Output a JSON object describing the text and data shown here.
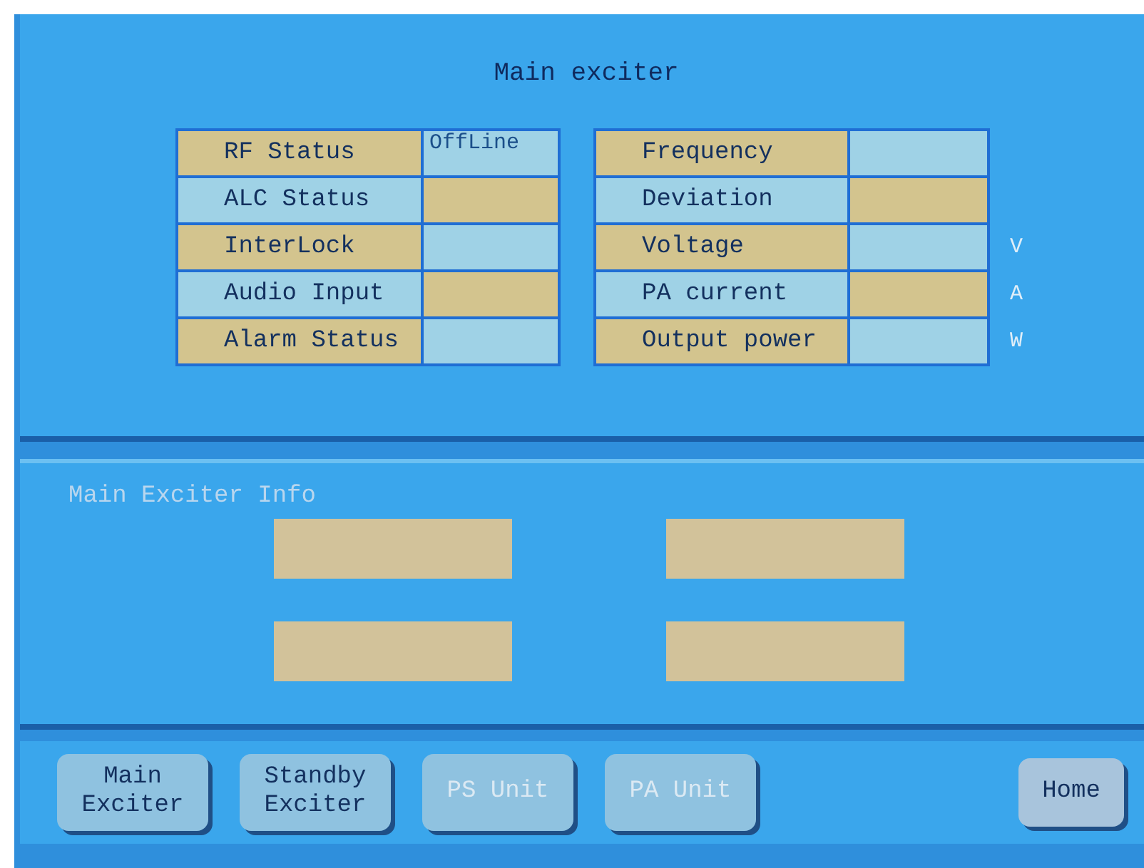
{
  "title": "Main exciter",
  "status_table": [
    {
      "label": "RF Status",
      "value": "OffLine"
    },
    {
      "label": "ALC Status"
    },
    {
      "label": "InterLock"
    },
    {
      "label": "Audio Input"
    },
    {
      "label": "Alarm Status"
    }
  ],
  "measure_table": [
    {
      "label": "Frequency"
    },
    {
      "label": "Deviation"
    },
    {
      "label": "Voltage",
      "unit": "V"
    },
    {
      "label": "PA current",
      "unit": "A"
    },
    {
      "label": "Output power",
      "unit": "W"
    }
  ],
  "info": {
    "title": "Main Exciter Info"
  },
  "nav_buttons": [
    {
      "label": "Main\nExciter",
      "disabled": false
    },
    {
      "label": "Standby\nExciter",
      "disabled": false
    },
    {
      "label": "PS Unit",
      "disabled": true
    },
    {
      "label": "PA Unit",
      "disabled": true
    }
  ],
  "home_button": {
    "label": "Home"
  }
}
